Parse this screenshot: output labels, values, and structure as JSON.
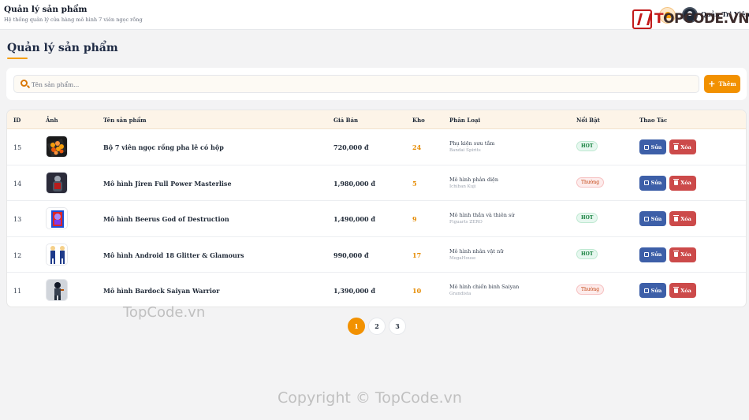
{
  "header": {
    "title": "Quản lý sản phẩm",
    "subtitle": "Hệ thống quản lý cửa hàng mô hình 7 viên ngọc rồng",
    "user_name": "Quản Trị Viên"
  },
  "logo": {
    "text_accent": "T",
    "text_main": "OPCODE.VN"
  },
  "page": {
    "title": "Quản lý sản phẩm"
  },
  "search": {
    "placeholder": "Tên sản phẩm...",
    "value": ""
  },
  "add_button_label": "Thêm",
  "table": {
    "columns": [
      "ID",
      "Ảnh",
      "Tên sản phẩm",
      "Giá Bán",
      "Kho",
      "Phân Loại",
      "Nổi Bật",
      "Thao Tác"
    ],
    "rows": [
      {
        "id": "15",
        "name": "Bộ 7 viên ngọc rồng pha lê có hộp",
        "price": "720,000 đ",
        "stock": "24",
        "category": "Phụ kiện sưu tầm",
        "brand": "Bandai Spirits",
        "badge": "HOT",
        "badge_type": "hot",
        "image": "dragon-balls-image"
      },
      {
        "id": "14",
        "name": "Mô hình Jiren Full Power Masterlise",
        "price": "1,980,000 đ",
        "stock": "5",
        "category": "Mô hình phản diện",
        "brand": "Ichiban Kuji",
        "badge": "Thường",
        "badge_type": "normal",
        "image": "jiren-figure-image"
      },
      {
        "id": "13",
        "name": "Mô hình Beerus God of Destruction",
        "price": "1,490,000 đ",
        "stock": "9",
        "category": "Mô hình thần và thiên sứ",
        "brand": "Figuarts ZERO",
        "badge": "HOT",
        "badge_type": "hot",
        "image": "beerus-box-image"
      },
      {
        "id": "12",
        "name": "Mô hình Android 18 Glitter & Glamours",
        "price": "990,000 đ",
        "stock": "17",
        "category": "Mô hình nhân vật nữ",
        "brand": "MegaHouse",
        "badge": "HOT",
        "badge_type": "hot",
        "image": "android-18-image"
      },
      {
        "id": "11",
        "name": "Mô hình Bardock Saiyan Warrior",
        "price": "1,390,000 đ",
        "stock": "10",
        "category": "Mô hình chiến binh Saiyan",
        "brand": "Grandista",
        "badge": "Thường",
        "badge_type": "normal",
        "image": "bardock-figure-image"
      }
    ],
    "edit_label": "Sửa",
    "delete_label": "Xóa"
  },
  "pagination": {
    "pages": [
      "1",
      "2",
      "3"
    ],
    "current": "1"
  },
  "watermarks": {
    "middle": "TopCode.vn",
    "bottom": "Copyright © TopCode.vn"
  },
  "colors": {
    "accent": "#f29100",
    "edit_button": "#3d5fa8",
    "delete_button": "#cc4a4a",
    "stock_text": "#e58a00",
    "brand_logo": "#c21a1a"
  }
}
